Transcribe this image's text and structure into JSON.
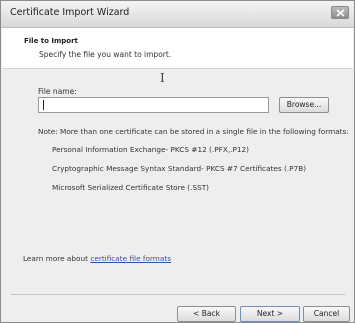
{
  "window": {
    "title": "Certificate Import Wizard"
  },
  "header": {
    "title": "File to Import",
    "subtitle": "Specify the file you want to import."
  },
  "file": {
    "label": "File name:",
    "value": "",
    "browse_label": "Browse..."
  },
  "note": {
    "text": "Note:  More than one certificate can be stored in a single file in the following formats:",
    "formats": [
      "Personal Information Exchange- PKCS #12 (.PFX,.P12)",
      "Cryptographic Message Syntax Standard- PKCS #7 Certificates (.P7B)",
      "Microsoft Serialized Certificate Store (.SST)"
    ]
  },
  "learn": {
    "prefix": "Learn more about ",
    "link": "certificate file formats"
  },
  "buttons": {
    "back": "< Back",
    "next": "Next >",
    "cancel": "Cancel"
  },
  "icons": {
    "close": "close-icon",
    "cursor": "text-cursor-icon"
  }
}
